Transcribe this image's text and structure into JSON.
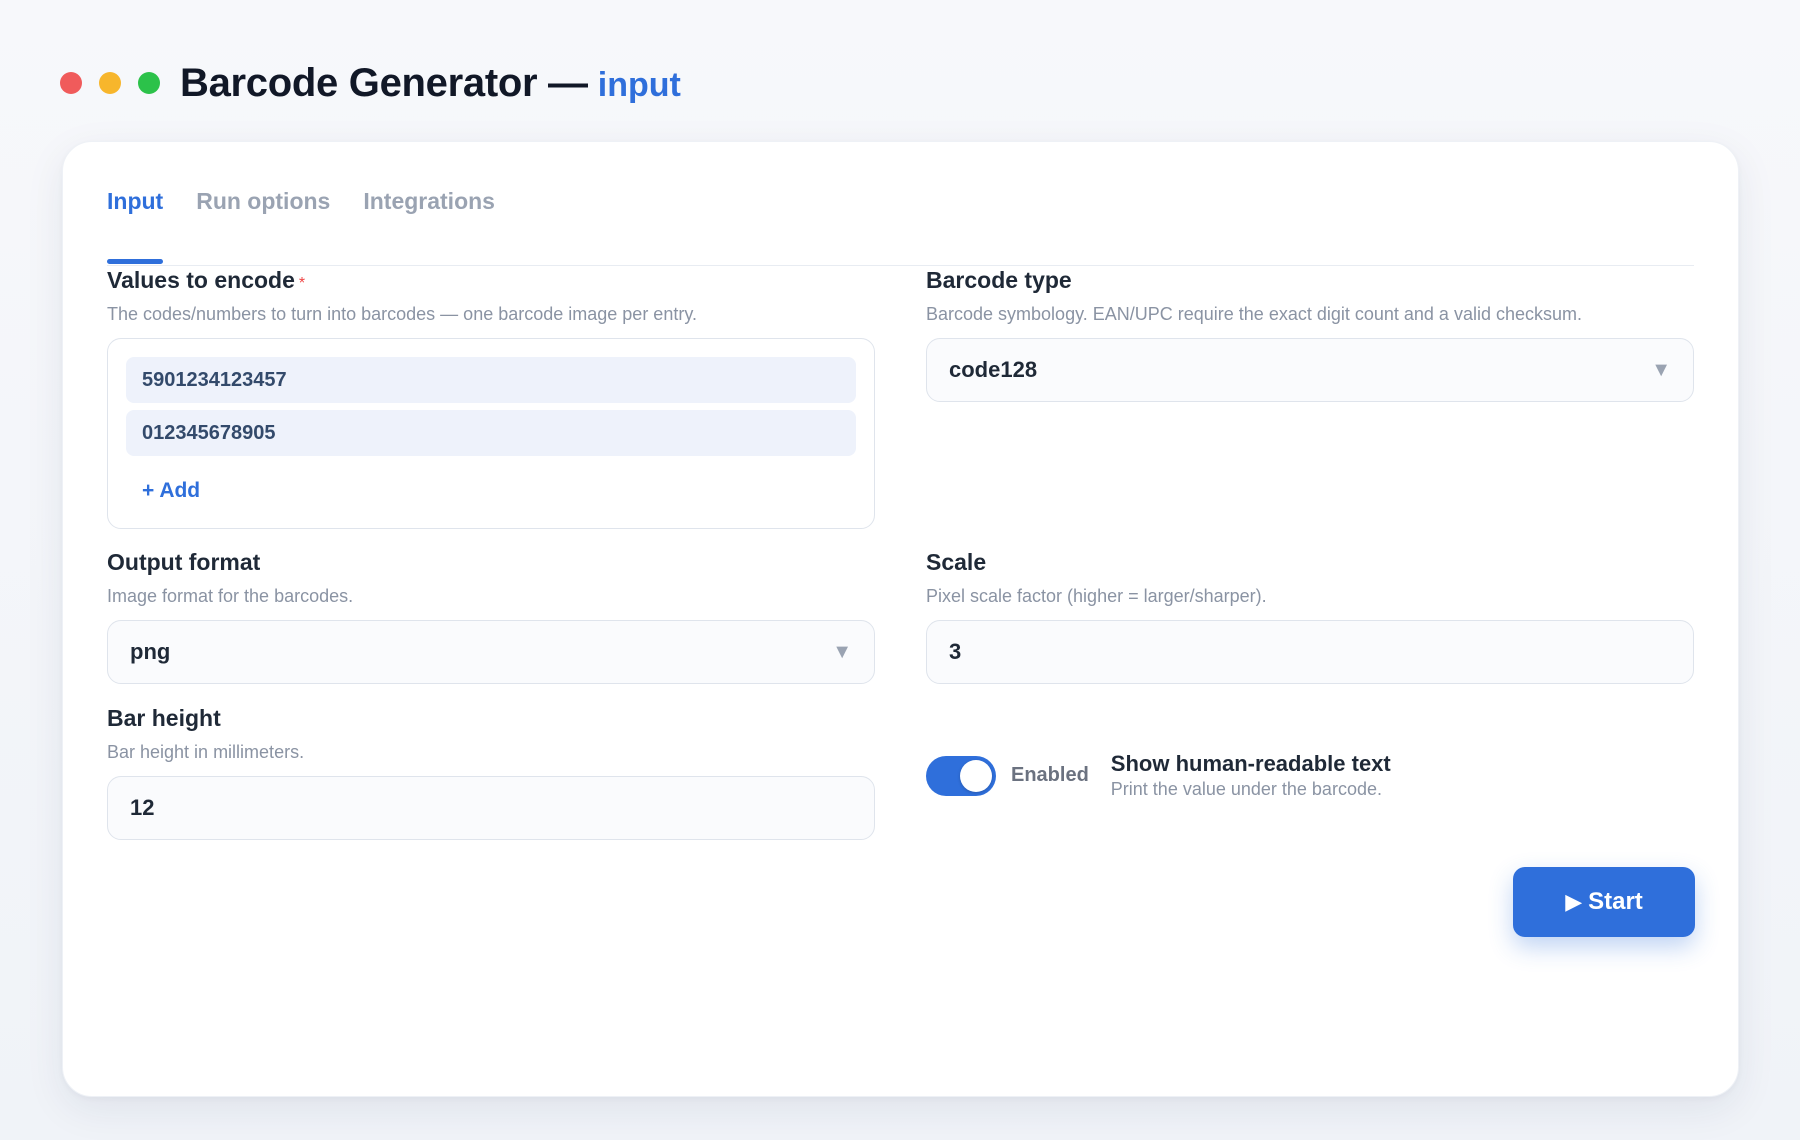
{
  "window": {
    "title": "Barcode Generator —",
    "subtitle": "input"
  },
  "tabs": [
    {
      "label": "Input",
      "active": true
    },
    {
      "label": "Run options",
      "active": false
    },
    {
      "label": "Integrations",
      "active": false
    }
  ],
  "values_field": {
    "label": "Values to encode",
    "required_mark": "*",
    "help": "The codes/numbers to turn into barcodes — one barcode image per entry.",
    "items": [
      "5901234123457",
      "012345678905"
    ],
    "add_label": "+ Add"
  },
  "barcode_type": {
    "label": "Barcode type",
    "help": "Barcode symbology. EAN/UPC require the exact digit count and a valid checksum.",
    "value": "code128"
  },
  "output_format": {
    "label": "Output format",
    "help": "Image format for the barcodes.",
    "value": "png"
  },
  "scale": {
    "label": "Scale",
    "help": "Pixel scale factor (higher = larger/sharper).",
    "value": "3"
  },
  "bar_height": {
    "label": "Bar height",
    "help": "Bar height in millimeters.",
    "value": "12"
  },
  "human_readable": {
    "state_label": "Enabled",
    "title": "Show human-readable text",
    "help": "Print the value under the barcode.",
    "enabled": true
  },
  "actions": {
    "start_icon": "▶",
    "start_label": "Start"
  },
  "colors": {
    "accent": "#2f6fdb",
    "required": "#ef4444",
    "close_dot": "#f05b5b",
    "minimize_dot": "#f7b62c",
    "maximize_dot": "#2cc24a"
  }
}
